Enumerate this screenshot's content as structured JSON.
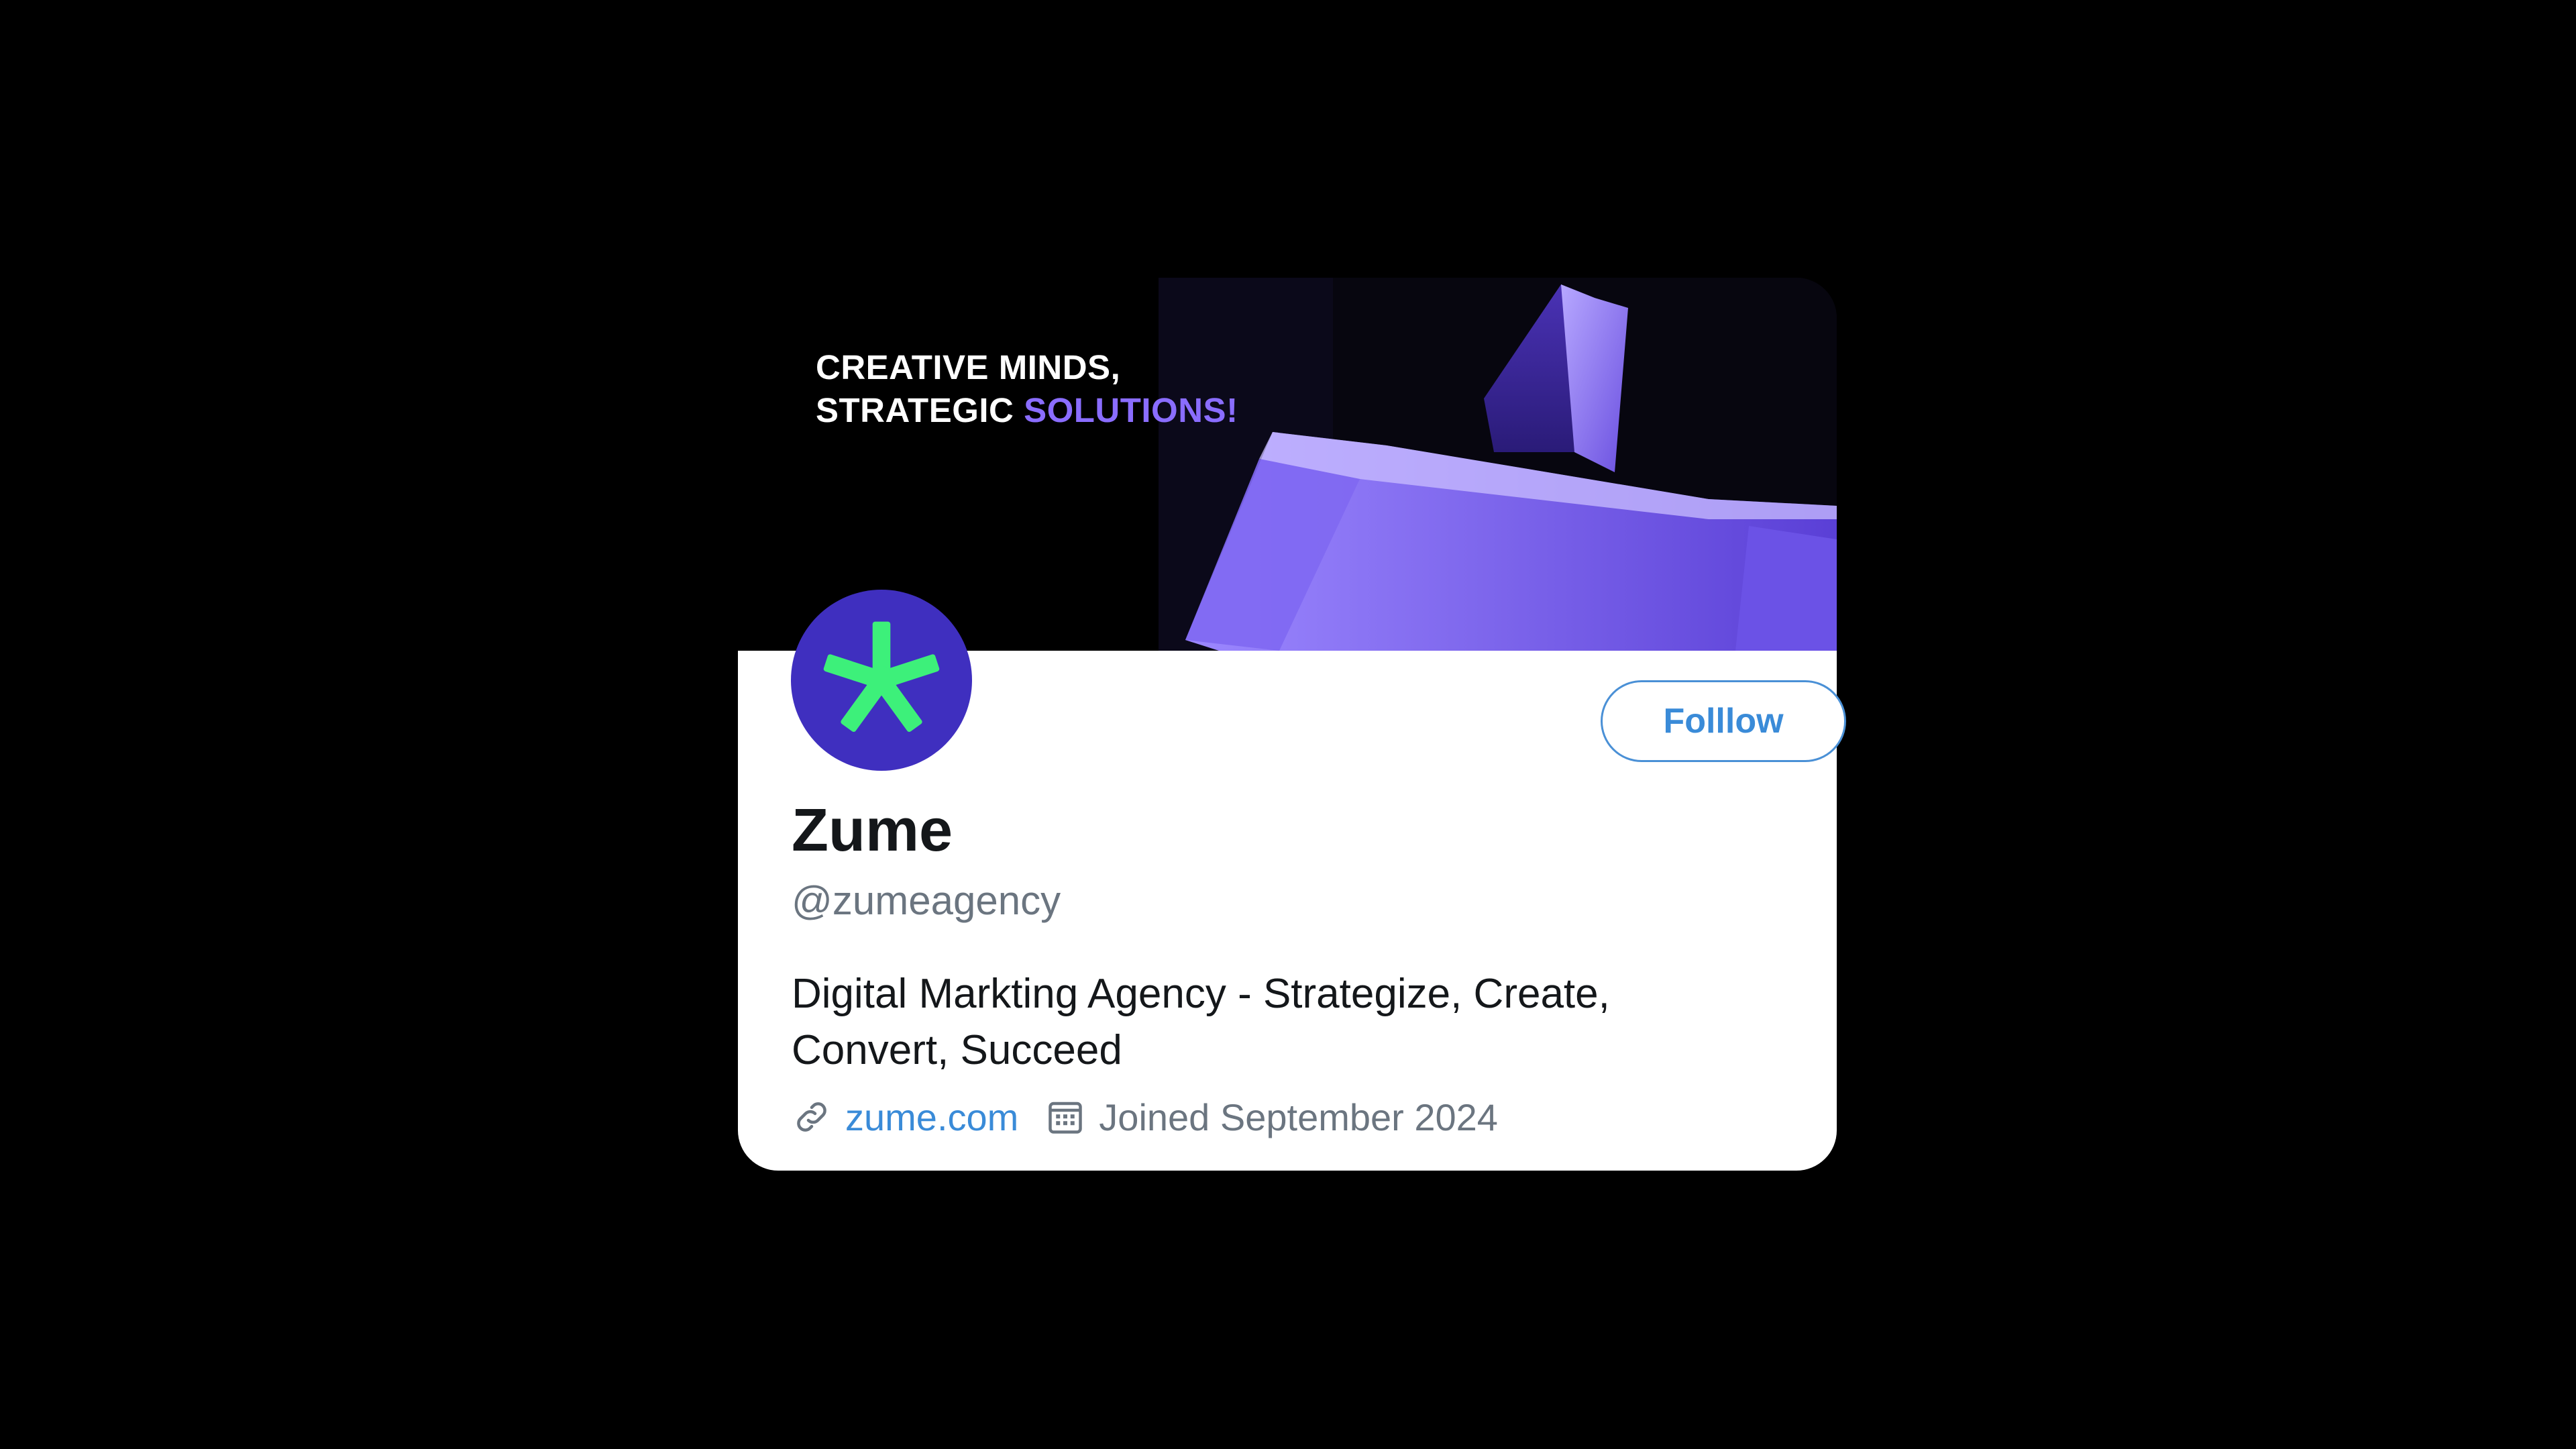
{
  "banner": {
    "headline_line1": "CREATIVE MINDS,",
    "headline_line2_prefix": "STRATEGIC ",
    "headline_line2_accent": "SOLUTIONS!"
  },
  "profile": {
    "display_name": "Zume",
    "handle": "@zumeagency",
    "bio": "Digital Markting Agency - Strategize, Create, Convert, Succeed",
    "website": "zume.com",
    "joined": "Joined September 2024",
    "follow_label": "Folllow"
  },
  "icons": {
    "avatar": "asterisk-logo-icon",
    "website": "link-icon",
    "joined": "calendar-icon"
  },
  "colors": {
    "background": "#000000",
    "avatar_bg": "#3f2fbf",
    "avatar_mark": "#3df07a",
    "accent": "#8a6dff",
    "link": "#3a8bd8",
    "muted": "#6b7580"
  }
}
